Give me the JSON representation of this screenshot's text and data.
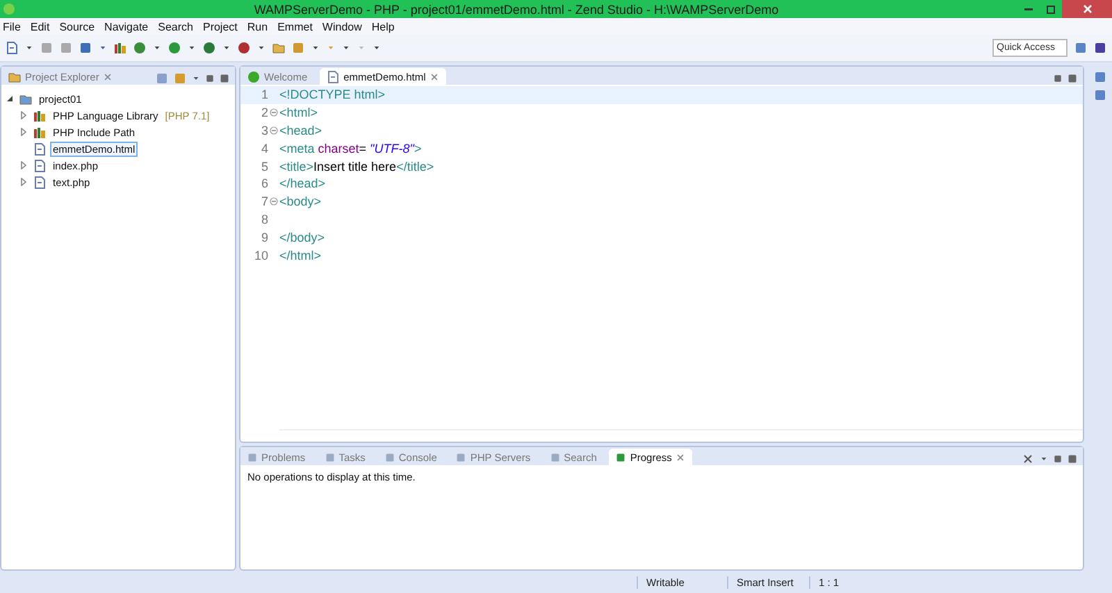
{
  "window": {
    "title": "WAMPServerDemo - PHP - project01/emmetDemo.html - Zend Studio - H:\\WAMPServerDemo"
  },
  "menu": [
    "File",
    "Edit",
    "Source",
    "Navigate",
    "Search",
    "Project",
    "Run",
    "Emmet",
    "Window",
    "Help"
  ],
  "quick_access": {
    "placeholder": "Quick Access"
  },
  "explorer": {
    "title": "Project Explorer",
    "tree": [
      {
        "label": "project01",
        "kind": "project",
        "expanded": true,
        "selected": false,
        "children": [
          {
            "label": "PHP Language Library",
            "suffix": "[PHP 7.1]",
            "kind": "library",
            "expanded": false,
            "selected": false
          },
          {
            "label": "PHP Include Path",
            "kind": "library",
            "expanded": false,
            "selected": false
          },
          {
            "label": "emmetDemo.html",
            "kind": "html",
            "selected": true
          },
          {
            "label": "index.php",
            "kind": "php",
            "expanded": false,
            "selected": false
          },
          {
            "label": "text.php",
            "kind": "php",
            "expanded": false,
            "selected": false
          }
        ]
      }
    ]
  },
  "editor": {
    "tabs": [
      {
        "label": "Welcome",
        "kind": "welcome",
        "selected": false
      },
      {
        "label": "emmetDemo.html",
        "kind": "file",
        "selected": true
      }
    ],
    "lines": [
      {
        "number": "1",
        "fold": false,
        "current": true,
        "segments": [
          {
            "kind": "tag",
            "text": "<!DOCTYPE html>"
          }
        ]
      },
      {
        "number": "2",
        "fold": true,
        "current": false,
        "segments": [
          {
            "kind": "tag",
            "text": "<html>"
          }
        ]
      },
      {
        "number": "3",
        "fold": true,
        "current": false,
        "segments": [
          {
            "kind": "tag",
            "text": "<head>"
          }
        ]
      },
      {
        "number": "4",
        "fold": false,
        "current": false,
        "segments": [
          {
            "kind": "tag",
            "text": "<meta"
          },
          {
            "kind": "attr",
            "text": " charset"
          },
          {
            "kind": "text",
            "text": "= "
          },
          {
            "kind": "value",
            "text": "\"UTF-8\""
          },
          {
            "kind": "tag",
            "text": ">"
          }
        ]
      },
      {
        "number": "5",
        "fold": false,
        "current": false,
        "segments": [
          {
            "kind": "tag",
            "text": "<title>"
          },
          {
            "kind": "text",
            "text": "Insert title here"
          },
          {
            "kind": "tag",
            "text": "</title>"
          }
        ]
      },
      {
        "number": "6",
        "fold": false,
        "current": false,
        "segments": [
          {
            "kind": "tag",
            "text": "</head>"
          }
        ]
      },
      {
        "number": "7",
        "fold": true,
        "current": false,
        "segments": [
          {
            "kind": "tag",
            "text": "<body>"
          }
        ]
      },
      {
        "number": "8",
        "fold": false,
        "current": false
      },
      {
        "number": "9",
        "fold": false,
        "current": false,
        "segments": [
          {
            "kind": "tag",
            "text": "</body>"
          }
        ]
      },
      {
        "number": "10",
        "fold": false,
        "current": false,
        "segments": [
          {
            "kind": "tag",
            "text": "</html>"
          }
        ]
      }
    ]
  },
  "bottom_panel": {
    "tabs": [
      {
        "label": "Problems",
        "selected": false
      },
      {
        "label": "Tasks",
        "selected": false
      },
      {
        "label": "Console",
        "selected": false
      },
      {
        "label": "PHP Servers",
        "selected": false
      },
      {
        "label": "Search",
        "selected": false
      },
      {
        "label": "Progress",
        "selected": true
      }
    ],
    "message": "No operations to display at this time."
  },
  "status_bar": [
    "Writable",
    "Smart Insert",
    "1 : 1"
  ]
}
